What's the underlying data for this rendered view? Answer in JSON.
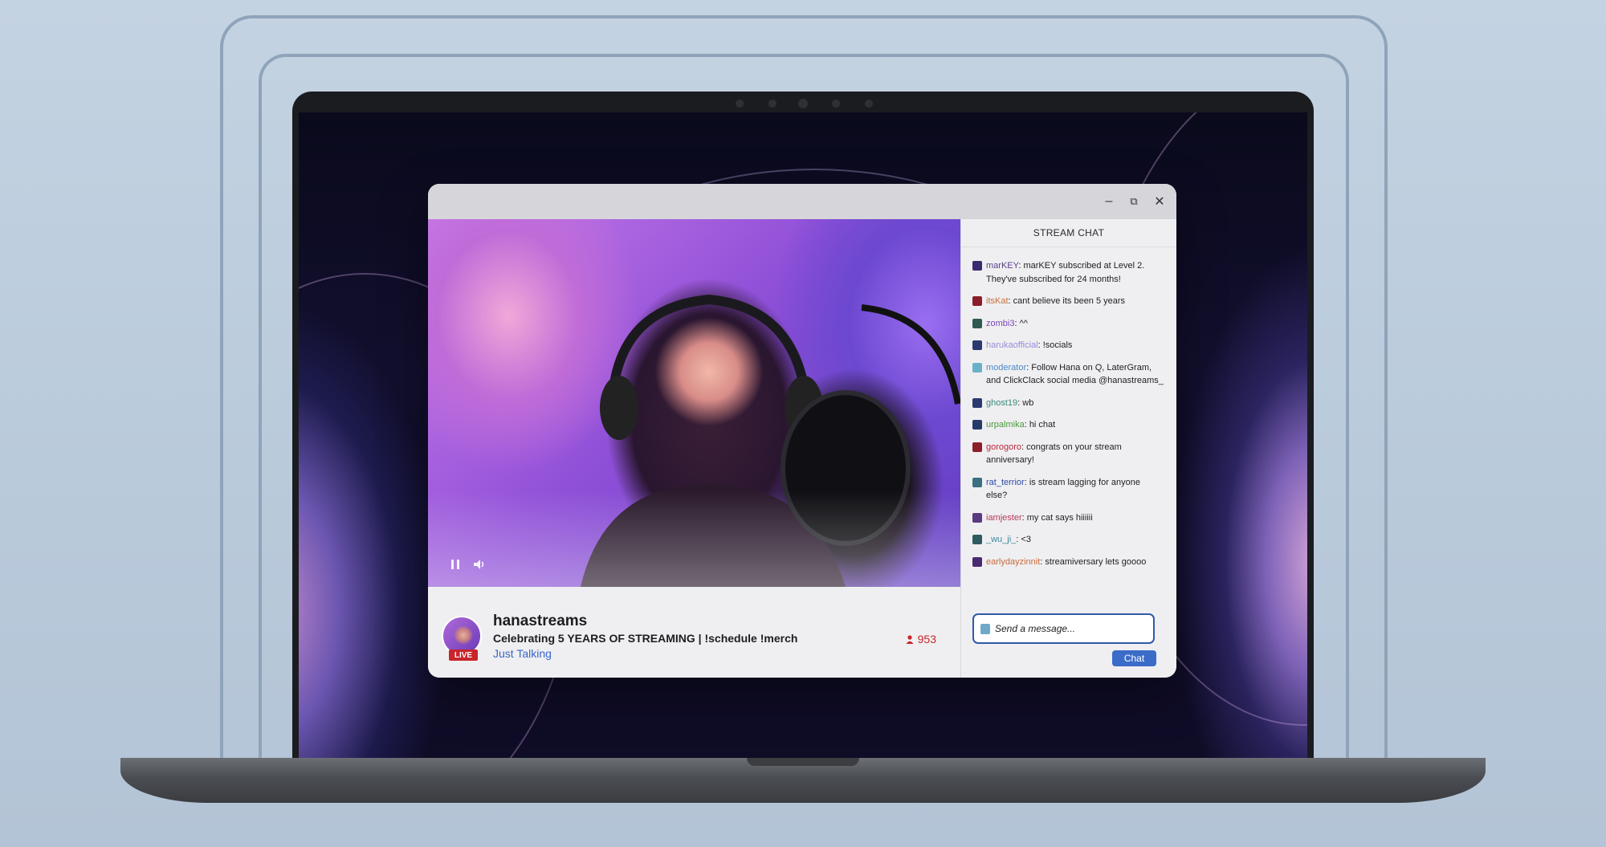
{
  "window": {
    "minimize": "–",
    "restore": "⧉",
    "close": "✕"
  },
  "stream": {
    "streamer": "hanastreams",
    "title": "Celebrating 5 YEARS OF STREAMING | !schedule !merch",
    "category": "Just Talking",
    "live_label": "LIVE",
    "viewers": "953"
  },
  "chat": {
    "header": "STREAM CHAT",
    "placeholder": "Send a message...",
    "send_label": "Chat",
    "messages": [
      {
        "user": "marKEY",
        "text": "marKEY subscribed at Level 2. They've subscribed for 24 months!",
        "color": "#5a3f8a",
        "badge": "#3a2a70"
      },
      {
        "user": "itsKat",
        "text": "cant believe its been 5 years",
        "color": "#c8703a",
        "badge": "#8a1e2a"
      },
      {
        "user": "zombi3",
        "text": "^^",
        "color": "#7a44b8",
        "badge": "#2e5a50"
      },
      {
        "user": "harukaofficial",
        "text": "!socials",
        "color": "#9a8ad8",
        "badge": "#2a3a70"
      },
      {
        "user": "moderator",
        "text": "Follow Hana on Q, LaterGram, and ClickClack social media @hanastreams_",
        "color": "#4a88c8",
        "badge": "#6ab0c8"
      },
      {
        "user": "ghost19",
        "text": "wb",
        "color": "#3a8a7a",
        "badge": "#2a3a70"
      },
      {
        "user": "urpalmika",
        "text": "hi chat",
        "color": "#4a9a3a",
        "badge": "#243a6a"
      },
      {
        "user": "gorogoro",
        "text": "congrats on your stream anniversary!",
        "color": "#b8283a",
        "badge": "#8a1e2a"
      },
      {
        "user": "rat_terrior",
        "text": "is stream lagging for anyone else?",
        "color": "#2a4aa8",
        "badge": "#3a7080"
      },
      {
        "user": "iamjester",
        "text": "my cat says hiiiiii",
        "color": "#b83a5a",
        "badge": "#5a3a80"
      },
      {
        "user": "_wu_ji_",
        "text": "<3",
        "color": "#3a8a9a",
        "badge": "#2e5a60"
      },
      {
        "user": "earlydayzinnit",
        "text": "streamiversary lets goooo",
        "color": "#c86a3a",
        "badge": "#4a2a70"
      }
    ]
  }
}
